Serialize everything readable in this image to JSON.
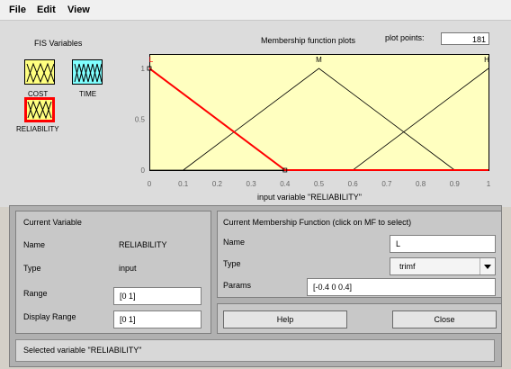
{
  "menu": {
    "file": "File",
    "edit": "Edit",
    "view": "View"
  },
  "fis_panel": {
    "title": "FIS Variables",
    "variables": [
      {
        "name": "COST",
        "color": "#ffff80",
        "kind": "input"
      },
      {
        "name": "TIME",
        "color": "#80ffff",
        "kind": "output"
      },
      {
        "name": "RELIABILITY",
        "color": "#ffff80",
        "kind": "input",
        "selected": true
      }
    ]
  },
  "plot": {
    "title": "Membership function plots",
    "plot_points_label": "plot points:",
    "plot_points_value": "181",
    "xlabel": "input variable \"RELIABILITY\"",
    "y_ticks": [
      "1",
      "0.5",
      "0"
    ],
    "x_ticks": [
      "0",
      "0.1",
      "0.2",
      "0.3",
      "0.4",
      "0.5",
      "0.6",
      "0.7",
      "0.8",
      "0.9",
      "1"
    ]
  },
  "chart_data": {
    "type": "line",
    "xlim": [
      0,
      1
    ],
    "ylim": [
      0,
      1
    ],
    "xlabel": "input variable \"RELIABILITY\"",
    "series": [
      {
        "name": "L",
        "x": [
          -0.4,
          0,
          0.4,
          1
        ],
        "y": [
          0,
          1,
          0,
          0
        ],
        "color": "#ff0000",
        "selected": true
      },
      {
        "name": "M",
        "x": [
          0.1,
          0.5,
          0.9
        ],
        "y": [
          0,
          1,
          0
        ],
        "color": "#000000"
      },
      {
        "name": "H",
        "x": [
          0,
          0.6,
          1
        ],
        "y": [
          0,
          0,
          1
        ],
        "color": "#000000"
      }
    ]
  },
  "current_variable": {
    "title": "Current Variable",
    "name_label": "Name",
    "name_value": "RELIABILITY",
    "type_label": "Type",
    "type_value": "input",
    "range_label": "Range",
    "range_value": "[0 1]",
    "display_range_label": "Display Range",
    "display_range_value": "[0 1]"
  },
  "current_mf": {
    "title": "Current Membership Function (click on MF to select)",
    "name_label": "Name",
    "name_value": "L",
    "type_label": "Type",
    "type_value": "trimf",
    "params_label": "Params",
    "params_value": "[-0.4 0 0.4]"
  },
  "buttons": {
    "help": "Help",
    "close": "Close"
  },
  "status": "Selected variable \"RELIABILITY\""
}
